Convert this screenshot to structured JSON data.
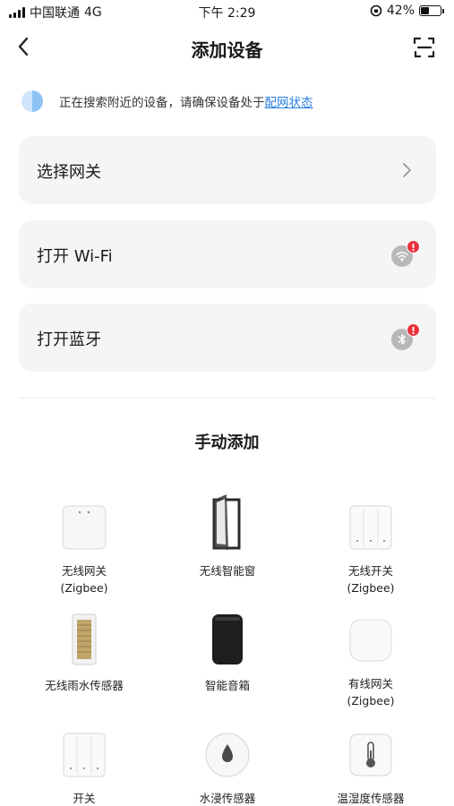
{
  "status_bar": {
    "carrier": "中国联通",
    "network": "4G",
    "time": "下午 2:29",
    "battery": "42%",
    "battery_level": 0.42
  },
  "nav": {
    "title": "添加设备",
    "back_icon": "chevron-left-icon",
    "scan_icon": "scan-icon"
  },
  "search_tip": {
    "text": "正在搜索附近的设备，请确保设备处于",
    "link": "配网状态"
  },
  "options": [
    {
      "label": "选择网关",
      "icon": "chevron-right-icon"
    },
    {
      "label": "打开 Wi-Fi",
      "icon": "wifi-off-icon"
    },
    {
      "label": "打开蓝牙",
      "icon": "bluetooth-off-icon"
    }
  ],
  "alert_mark": "!",
  "manual_title": "手动添加",
  "devices": [
    {
      "name": "无线网关",
      "sub": "(Zigbee)",
      "icon": "gateway-icon"
    },
    {
      "name": "无线智能窗",
      "sub": "",
      "icon": "smart-window-icon"
    },
    {
      "name": "无线开关",
      "sub": "(Zigbee)",
      "icon": "wall-switch-icon"
    },
    {
      "name": "无线雨水传感器",
      "sub": "",
      "icon": "rain-sensor-icon"
    },
    {
      "name": "智能音箱",
      "sub": "",
      "icon": "smart-speaker-icon"
    },
    {
      "name": "有线网关",
      "sub": "(Zigbee)",
      "icon": "wired-gateway-icon"
    },
    {
      "name": "开关",
      "sub": "",
      "icon": "switch-icon"
    },
    {
      "name": "水浸传感器",
      "sub": "",
      "icon": "water-sensor-icon"
    },
    {
      "name": "温湿度传感器",
      "sub": "",
      "icon": "thermometer-sensor-icon"
    }
  ]
}
